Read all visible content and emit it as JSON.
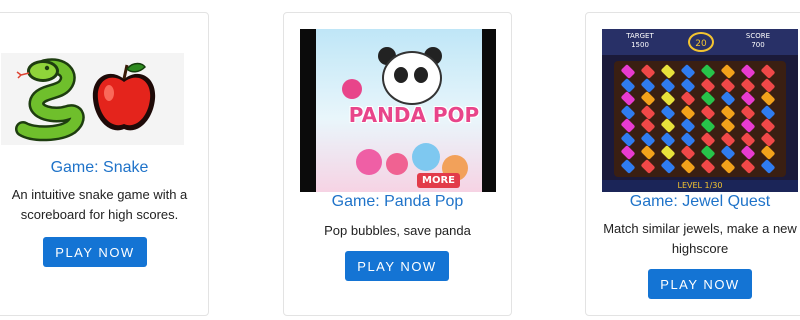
{
  "play_label": "PLAY NOW",
  "games": [
    {
      "title": "Game: Snake",
      "description": "An intuitive snake game with a scoreboard for high scores."
    },
    {
      "title": "Game: Panda Pop",
      "description": "Pop bubbles, save panda",
      "thumb_logo_text": "PANDA POP",
      "thumb_more_text": "MORE"
    },
    {
      "title": "Game: Jewel Quest",
      "description": "Match similar jewels, make a new highscore",
      "thumb_target_label": "TARGET",
      "thumb_target_value": "1500",
      "thumb_moves_value": "20",
      "thumb_score_label": "SCORE",
      "thumb_score_value": "700",
      "thumb_level_text": "LEVEL 1/30"
    }
  ],
  "colors": {
    "title_link": "#1f73c9",
    "button_bg": "#1474d4",
    "button_text": "#ffffff",
    "card_border": "#e3e3e3"
  },
  "icons": [
    "snake-icon",
    "apple-icon"
  ]
}
